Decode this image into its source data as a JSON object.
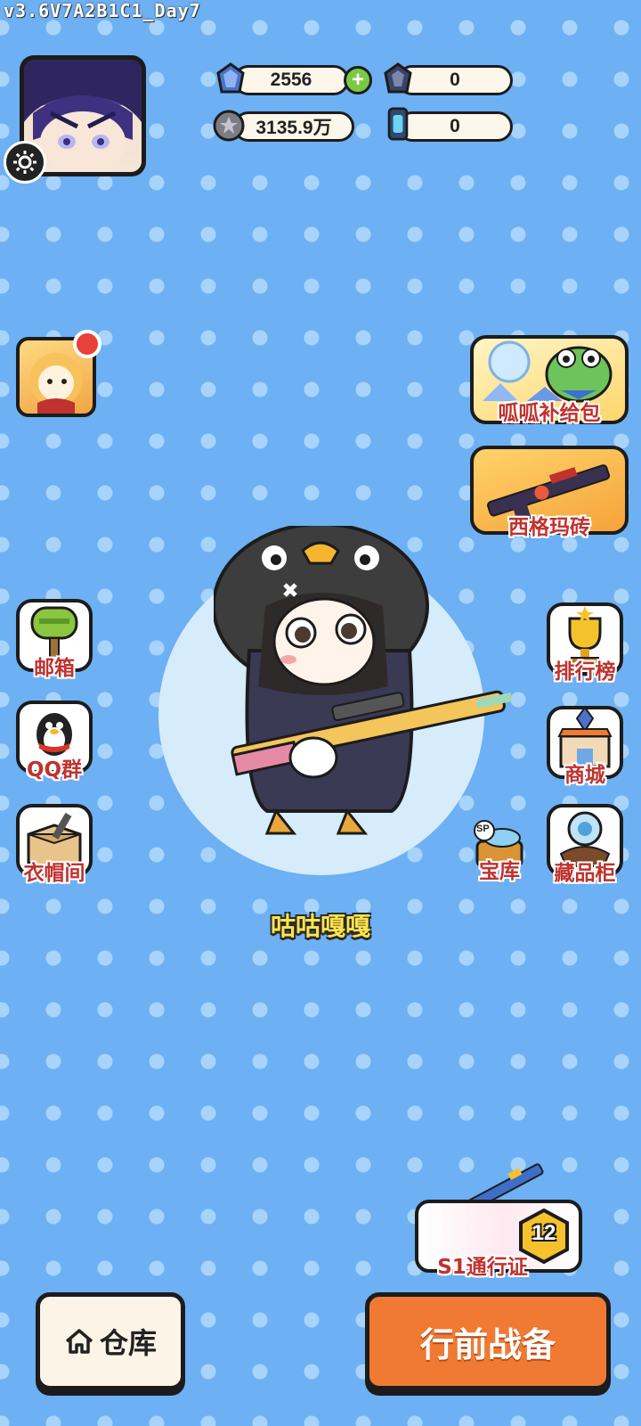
{
  "version": "v3.6V7A2B1C1_Day7",
  "currencies": {
    "gems": "2556",
    "shards": "0",
    "coins": "3135.9万",
    "tickets": "0",
    "plus_symbol": "+"
  },
  "right_promos": {
    "supply_pack": "呱呱补给包",
    "sigma_brick": "西格玛砖"
  },
  "left_menu": {
    "mailbox": "邮箱",
    "qq_group": "QQ群",
    "wardrobe": "衣帽间"
  },
  "right_menu": {
    "leaderboard": "排行榜",
    "shop": "商城",
    "vault": "宝库",
    "vault_badge": "SP",
    "collection": "藏品柜"
  },
  "player_name": "咕咕嘎嘎",
  "battle_pass": {
    "label": "S1通行证",
    "level": "12"
  },
  "bottom": {
    "warehouse": "仓库",
    "battle_prep": "行前战备"
  },
  "colors": {
    "background": "#6db0f3",
    "label_red": "#c0322e",
    "battle_orange": "#f07a33",
    "name_yellow": "#ffe44a"
  }
}
